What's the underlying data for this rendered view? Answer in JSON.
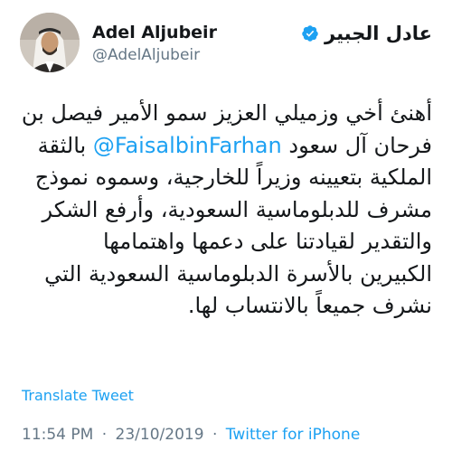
{
  "user": {
    "display_name": "Adel Aljubeir",
    "handle": "@AdelAljubeir",
    "arabic_name": "عادل الجبير",
    "verified_icon": "verified-badge-icon",
    "accent": "#1da1f2"
  },
  "tweet": {
    "text_lines": [
      "أهنئ أخي وزميلي العزيز سمو الأمير فيصل بن",
      "فرحان آل سعود",
      "بالثقة",
      "الملكية بتعيينه وزيراً للخارجية، وسموه نموذج",
      "مشرف للدبلوماسية السعودية، وأرفع الشكر",
      "والتقدير لقيادتنا على دعمها واهتمامها",
      "الكبيرين بالأسرة الدبلوماسية السعودية التي",
      "نشرف جميعاً بالانتساب لها."
    ],
    "mention": "@FaisalbinFarhan"
  },
  "actions": {
    "translate_label": "Translate Tweet"
  },
  "meta": {
    "time": "11:54 PM",
    "date": "23/10/2019",
    "separator": "·",
    "source": "Twitter for iPhone"
  }
}
